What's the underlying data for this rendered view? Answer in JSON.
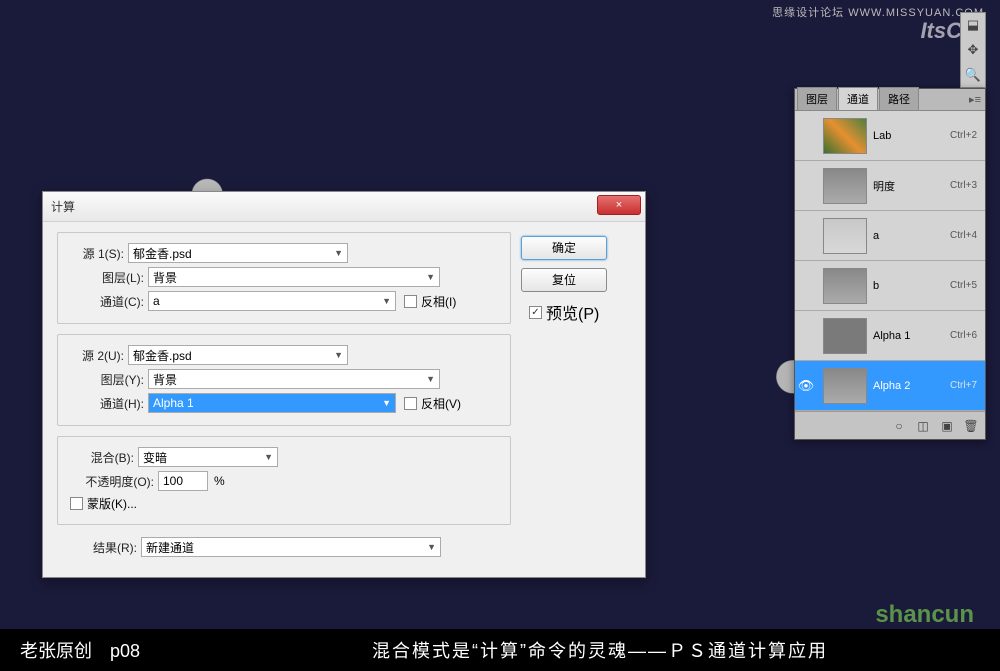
{
  "watermarks": {
    "top1": "思缘设计论坛  WWW.MISSYUAN.COM",
    "top2": "ItsCN.",
    "bottom": "shancun"
  },
  "dialog": {
    "title": "计算",
    "close": "×",
    "source1": {
      "legend": "源 1(S):",
      "file": "郁金香.psd",
      "layer_label": "图层(L):",
      "layer": "背景",
      "channel_label": "通道(C):",
      "channel": "a",
      "invert_label": "反相(I)",
      "invert": false
    },
    "source2": {
      "legend": "源 2(U):",
      "file": "郁金香.psd",
      "layer_label": "图层(Y):",
      "layer": "背景",
      "channel_label": "通道(H):",
      "channel": "Alpha 1",
      "invert_label": "反相(V)",
      "invert": false
    },
    "blend": {
      "label": "混合(B):",
      "mode": "变暗",
      "opacity_label": "不透明度(O):",
      "opacity": "100",
      "opacity_unit": "%",
      "mask_label": "蒙版(K)...",
      "mask": false
    },
    "result": {
      "label": "结果(R):",
      "value": "新建通道"
    },
    "buttons": {
      "ok": "确定",
      "reset": "复位"
    },
    "preview": {
      "label": "预览(P)",
      "checked": true
    }
  },
  "channels_panel": {
    "tabs": [
      "图层",
      "通道",
      "路径"
    ],
    "active_tab": 1,
    "menu": "▸≡",
    "rows": [
      {
        "name": "Lab",
        "shortcut": "Ctrl+2",
        "thumb": "color",
        "eye": false,
        "sel": false
      },
      {
        "name": "明度",
        "shortcut": "Ctrl+3",
        "thumb": "gray",
        "eye": false,
        "sel": false
      },
      {
        "name": "a",
        "shortcut": "Ctrl+4",
        "thumb": "light",
        "eye": false,
        "sel": false
      },
      {
        "name": "b",
        "shortcut": "Ctrl+5",
        "thumb": "gray",
        "eye": false,
        "sel": false
      },
      {
        "name": "Alpha 1",
        "shortcut": "Ctrl+6",
        "thumb": "solid",
        "eye": false,
        "sel": false
      },
      {
        "name": "Alpha 2",
        "shortcut": "Ctrl+7",
        "thumb": "gray",
        "eye": true,
        "sel": true
      }
    ],
    "footer_icons": [
      "○",
      "◫",
      "▣",
      "🗑"
    ]
  },
  "tools": [
    "⬓",
    "✥",
    "🔍"
  ],
  "caption": {
    "left": "老张原创　p08",
    "right": "混合模式是“计算”命令的灵魂——ＰＳ通道计算应用"
  }
}
